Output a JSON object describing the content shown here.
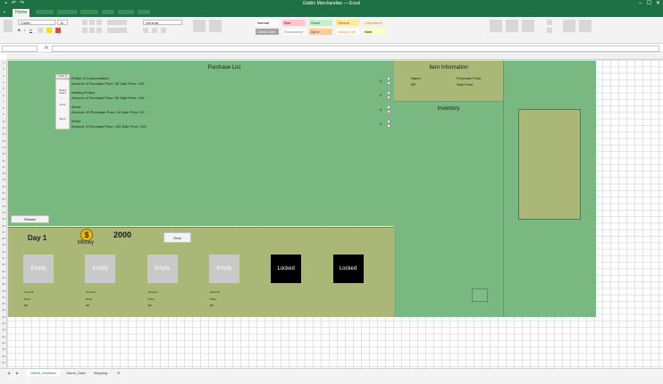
{
  "window": {
    "title": "Goblin Merchandise — Excel",
    "controls": [
      "–",
      "☐",
      "✕"
    ]
  },
  "ribbon": {
    "active_tab": "Home",
    "font_name": "Calibri",
    "font_size": "11",
    "number_format": "General",
    "styles": [
      {
        "label": "Normal",
        "bg": "#ffffff",
        "fg": "#000000"
      },
      {
        "label": "Bad",
        "bg": "#ffc7ce",
        "fg": "#9c0006"
      },
      {
        "label": "Good",
        "bg": "#c6efce",
        "fg": "#006100"
      },
      {
        "label": "Neutral",
        "bg": "#ffeb9c",
        "fg": "#9c5700"
      },
      {
        "label": "Calculation",
        "bg": "#f2f2f2",
        "fg": "#fa7d00"
      },
      {
        "label": "Check Cell",
        "bg": "#a5a5a5",
        "fg": "#ffffff"
      },
      {
        "label": "Explanatory",
        "bg": "#ffffff",
        "fg": "#7f7f7f"
      },
      {
        "label": "Input",
        "bg": "#ffcc99",
        "fg": "#3f3f76"
      },
      {
        "label": "Linked Cell",
        "bg": "#ffffff",
        "fg": "#fa7d00"
      },
      {
        "label": "Note",
        "bg": "#ffffcc",
        "fg": "#000000"
      }
    ]
  },
  "purchase": {
    "title": "Purchase List",
    "items": [
      {
        "icon_label": "Potion of Concentration",
        "name": "Potion of Concentration",
        "details": "Amount: 5  Purchase Price: 50  Sale Price: 100",
        "qty": "0"
      },
      {
        "icon_label": "Healing Potion",
        "name": "Healing Potion",
        "details": "Amount: 5  Purchase Price: 50  Sale Price: 100",
        "qty": "0"
      },
      {
        "icon_label": "Arrow",
        "name": "Arrow",
        "details": "Amount: 20  Purchase Price: 10  Sale Price: 20",
        "qty": "0"
      },
      {
        "icon_label": "Bomb",
        "name": "Bomb",
        "details": "Amount: 5  Purchase Price: 100  Sale Price: 200",
        "qty": "0"
      }
    ],
    "restart_label": "Restart"
  },
  "item_info": {
    "title": "Item Information",
    "name_label": "Name:",
    "bp_label": "BP:",
    "purchase_label": "Purchase Price:",
    "sale_label": "Sale Price:"
  },
  "inventory": {
    "title": "Inventory"
  },
  "status": {
    "day": "Day 1",
    "money_label": "Money",
    "money_value": "2000",
    "deal_label": "Deal"
  },
  "slots": [
    {
      "label": "Empty",
      "locked": false,
      "amount": "Amount:",
      "price": "Price:",
      "bp": "BP:"
    },
    {
      "label": "Empty",
      "locked": false,
      "amount": "Amount:",
      "price": "Price:",
      "bp": "BP:"
    },
    {
      "label": "Empty",
      "locked": false,
      "amount": "Amount:",
      "price": "Price:",
      "bp": "BP:"
    },
    {
      "label": "Empty",
      "locked": false,
      "amount": "Amount:",
      "price": "Price:",
      "bp": "BP:"
    },
    {
      "label": "Locked",
      "locked": true
    },
    {
      "label": "Locked",
      "locked": true
    }
  ],
  "sheets": [
    "Game_Interface",
    "Game_Data",
    "Mapping"
  ],
  "active_sheet": "Game_Interface"
}
